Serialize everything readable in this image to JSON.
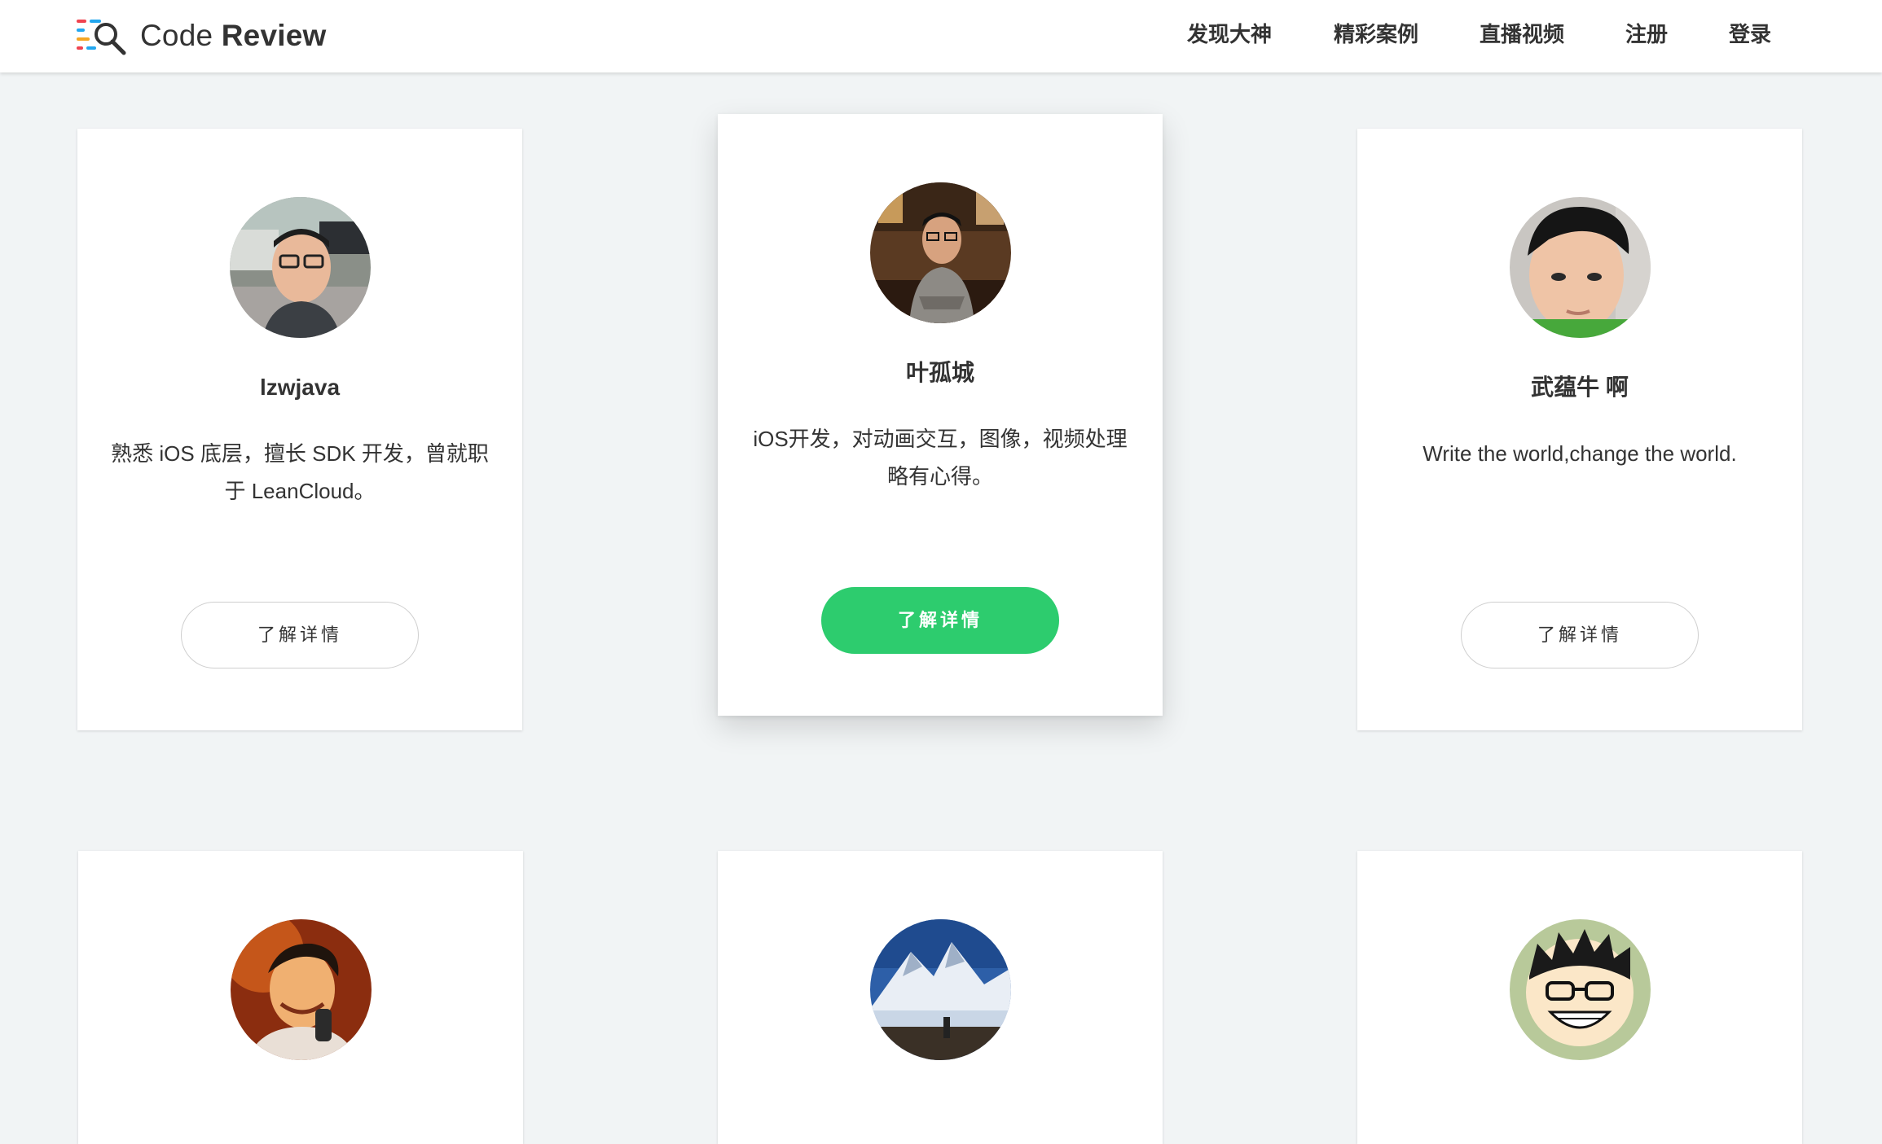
{
  "header": {
    "brand_prefix": "Code",
    "brand_main": "Review",
    "nav": [
      {
        "label": "发现大神",
        "icon": null
      },
      {
        "label": "精彩案例",
        "icon": null
      },
      {
        "label": "直播视频",
        "icon": null
      },
      {
        "label": "注册",
        "icon": null
      },
      {
        "label": "登录",
        "icon": null
      }
    ]
  },
  "cards": [
    {
      "name": "lzwjava",
      "desc": "熟悉 iOS 底层，擅长 SDK 开发，曾就职于 LeanCloud。",
      "button": "了解详情",
      "avatar": "avatar-lzwjava"
    },
    {
      "name": "叶孤城",
      "desc": "iOS开发，对动画交互，图像，视频处理略有心得。",
      "button": "了解详情",
      "avatar": "avatar-yeguchen",
      "highlighted": true
    },
    {
      "name": "武蕴牛 啊",
      "desc": "Write the world,change the world.",
      "button": "了解详情",
      "avatar": "avatar-wuyunniu"
    },
    {
      "avatar": "avatar-user-4"
    },
    {
      "avatar": "avatar-user-5"
    },
    {
      "avatar": "avatar-user-6"
    }
  ],
  "colors": {
    "accent": "#2dcc6e",
    "background": "#f1f4f5",
    "logo_red": "#f0434f",
    "logo_blue": "#22a7f0",
    "logo_yellow": "#f5a623"
  }
}
